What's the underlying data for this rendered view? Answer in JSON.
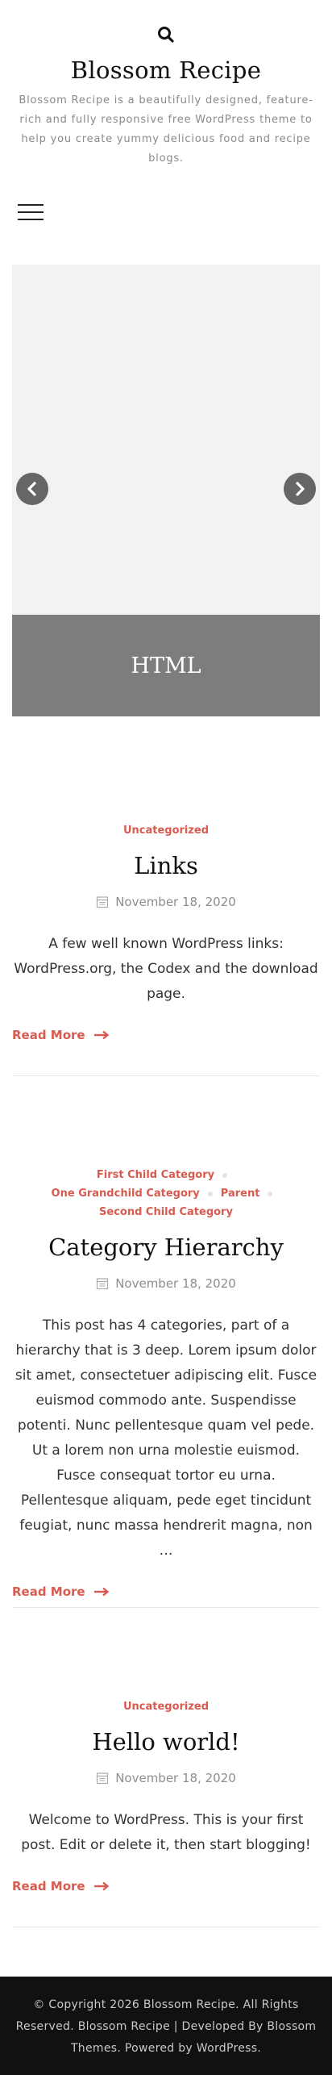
{
  "header": {
    "site_title": "Blossom Recipe",
    "site_description": "Blossom Recipe is a beautifully designed, feature-rich and fully responsive free WordPress theme to help you create yummy delicious food and recipe blogs."
  },
  "slider": {
    "caption": "HTML"
  },
  "posts": [
    {
      "categories": [
        "Uncategorized"
      ],
      "title": "Links",
      "date": "November 18, 2020",
      "excerpt": "A few well known WordPress links: WordPress.org, the Codex and the download page.",
      "read_more": "Read More"
    },
    {
      "categories": [
        "First Child Category",
        "One Grandchild Category",
        "Parent",
        "Second Child Category"
      ],
      "title": "Category Hierarchy",
      "date": "November 18, 2020",
      "excerpt": "This post has 4 categories, part of a hierarchy that is 3 deep. Lorem ipsum dolor sit amet, consectetuer adipiscing elit. Fusce euismod commodo ante. Suspendisse potenti. Nunc pellentesque quam vel pede. Ut a lorem non urna molestie euismod. Fusce consequat tortor eu urna. Pellentesque aliquam, pede eget tincidunt feugiat, nunc massa hendrerit magna, non …",
      "read_more": "Read More"
    },
    {
      "categories": [
        "Uncategorized"
      ],
      "title": "Hello world!",
      "date": "November 18, 2020",
      "excerpt": "Welcome to WordPress. This is your first post. Edit or delete it, then start blogging!",
      "read_more": "Read More"
    }
  ],
  "footer": {
    "copyright": "© Copyright 2026 Blossom Recipe. All Rights Reserved.",
    "theme_credit": "Blossom Recipe | Developed By",
    "developer_link": "Blossom Themes",
    "powered_by": "Powered by",
    "wordpress_link": "WordPress."
  },
  "colors": {
    "accent": "#d85b4f",
    "footer_bg": "#111111",
    "slider_caption_bg": "#7d7d7d"
  },
  "icons": {
    "search": "search-icon",
    "menu": "hamburger-icon",
    "prev": "chevron-left-icon",
    "next": "chevron-right-icon",
    "date": "calendar-icon",
    "read_more": "arrow-right-icon"
  }
}
